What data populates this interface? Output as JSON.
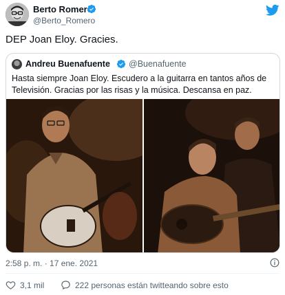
{
  "author": {
    "name": "Berto Romero",
    "handle": "@Berto_Romero",
    "avatar_icon": "person-glasses-avatar",
    "verified_icon": "verified-badge-icon"
  },
  "tweet": {
    "text": "DEP Joan Eloy. Gracies."
  },
  "quoted": {
    "name": "Andreu Buenafuente",
    "handle": "@Buenafuente",
    "text": "Hasta siempre Joan Eloy. Escudero a la guitarra en tantos años de Televisión. Gracias por las risas y la música. Descansa en paz."
  },
  "meta": {
    "timestamp": "2:58 p. m. · 17 ene. 2021",
    "likes": "3,1 mil",
    "talking": "222 personas están twitteando sobre esto"
  },
  "colors": {
    "brand": "#1d9bf0",
    "text": "#0f1419",
    "muted": "#536471",
    "border": "#cfd9de"
  }
}
